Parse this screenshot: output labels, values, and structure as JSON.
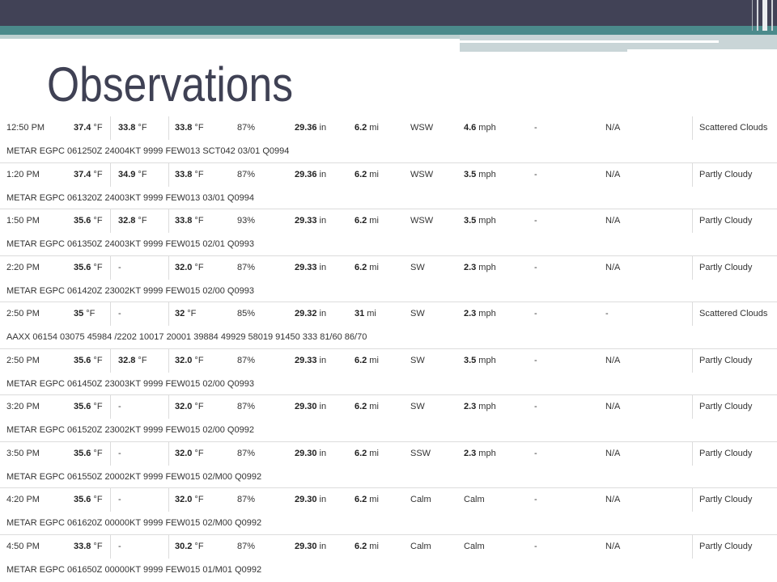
{
  "slide": {
    "title": "Observations"
  },
  "colors": {
    "header_bar": "#414256",
    "accent": "#4b8a8b",
    "title": "#3f4154",
    "rule": "#dcdcdc",
    "text": "#333333"
  },
  "observations": [
    {
      "cells": [
        [
          "12:50 PM"
        ],
        [
          "37.4",
          "°F"
        ],
        [
          "33.8",
          "°F"
        ],
        [
          "33.8",
          "°F"
        ],
        [
          "87%"
        ],
        [
          "29.36",
          "in"
        ],
        [
          "6.2",
          "mi"
        ],
        [
          "WSW"
        ],
        [
          "4.6",
          "mph"
        ],
        [
          "-"
        ],
        [
          "N/A"
        ],
        [
          "Scattered Clouds"
        ]
      ],
      "report": "METAR EGPC 061250Z 24004KT 9999 FEW013 SCT042 03/01 Q0994"
    },
    {
      "cells": [
        [
          "1:20 PM"
        ],
        [
          "37.4",
          "°F"
        ],
        [
          "34.9",
          "°F"
        ],
        [
          "33.8",
          "°F"
        ],
        [
          "87%"
        ],
        [
          "29.36",
          "in"
        ],
        [
          "6.2",
          "mi"
        ],
        [
          "WSW"
        ],
        [
          "3.5",
          "mph"
        ],
        [
          "-"
        ],
        [
          "N/A"
        ],
        [
          "Partly Cloudy"
        ]
      ],
      "report": "METAR EGPC 061320Z 24003KT 9999 FEW013 03/01 Q0994"
    },
    {
      "cells": [
        [
          "1:50 PM"
        ],
        [
          "35.6",
          "°F"
        ],
        [
          "32.8",
          "°F"
        ],
        [
          "33.8",
          "°F"
        ],
        [
          "93%"
        ],
        [
          "29.33",
          "in"
        ],
        [
          "6.2",
          "mi"
        ],
        [
          "WSW"
        ],
        [
          "3.5",
          "mph"
        ],
        [
          "-"
        ],
        [
          "N/A"
        ],
        [
          "Partly Cloudy"
        ]
      ],
      "report": "METAR EGPC 061350Z 24003KT 9999 FEW015 02/01 Q0993"
    },
    {
      "cells": [
        [
          "2:20 PM"
        ],
        [
          "35.6",
          "°F"
        ],
        [
          "-"
        ],
        [
          "32.0",
          "°F"
        ],
        [
          "87%"
        ],
        [
          "29.33",
          "in"
        ],
        [
          "6.2",
          "mi"
        ],
        [
          "SW"
        ],
        [
          "2.3",
          "mph"
        ],
        [
          "-"
        ],
        [
          "N/A"
        ],
        [
          "Partly Cloudy"
        ]
      ],
      "report": "METAR EGPC 061420Z 23002KT 9999 FEW015 02/00 Q0993"
    },
    {
      "cells": [
        [
          "2:50 PM"
        ],
        [
          "35",
          "°F"
        ],
        [
          "-"
        ],
        [
          "32",
          "°F"
        ],
        [
          "85%"
        ],
        [
          "29.32",
          "in"
        ],
        [
          "31",
          "mi"
        ],
        [
          "SW"
        ],
        [
          "2.3",
          "mph"
        ],
        [
          "-"
        ],
        [
          "-"
        ],
        [
          "Scattered Clouds"
        ]
      ],
      "report": "AAXX 06154 03075 45984 /2202 10017 20001 39884 49929 58019 91450 333 81/60 86/70"
    },
    {
      "cells": [
        [
          "2:50 PM"
        ],
        [
          "35.6",
          "°F"
        ],
        [
          "32.8",
          "°F"
        ],
        [
          "32.0",
          "°F"
        ],
        [
          "87%"
        ],
        [
          "29.33",
          "in"
        ],
        [
          "6.2",
          "mi"
        ],
        [
          "SW"
        ],
        [
          "3.5",
          "mph"
        ],
        [
          "-"
        ],
        [
          "N/A"
        ],
        [
          "Partly Cloudy"
        ]
      ],
      "report": "METAR EGPC 061450Z 23003KT 9999 FEW015 02/00 Q0993"
    },
    {
      "cells": [
        [
          "3:20 PM"
        ],
        [
          "35.6",
          "°F"
        ],
        [
          "-"
        ],
        [
          "32.0",
          "°F"
        ],
        [
          "87%"
        ],
        [
          "29.30",
          "in"
        ],
        [
          "6.2",
          "mi"
        ],
        [
          "SW"
        ],
        [
          "2.3",
          "mph"
        ],
        [
          "-"
        ],
        [
          "N/A"
        ],
        [
          "Partly Cloudy"
        ]
      ],
      "report": "METAR EGPC 061520Z 23002KT 9999 FEW015 02/00 Q0992"
    },
    {
      "cells": [
        [
          "3:50 PM"
        ],
        [
          "35.6",
          "°F"
        ],
        [
          "-"
        ],
        [
          "32.0",
          "°F"
        ],
        [
          "87%"
        ],
        [
          "29.30",
          "in"
        ],
        [
          "6.2",
          "mi"
        ],
        [
          "SSW"
        ],
        [
          "2.3",
          "mph"
        ],
        [
          "-"
        ],
        [
          "N/A"
        ],
        [
          "Partly Cloudy"
        ]
      ],
      "report": "METAR EGPC 061550Z 20002KT 9999 FEW015 02/M00 Q0992"
    },
    {
      "cells": [
        [
          "4:20 PM"
        ],
        [
          "35.6",
          "°F"
        ],
        [
          "-"
        ],
        [
          "32.0",
          "°F"
        ],
        [
          "87%"
        ],
        [
          "29.30",
          "in"
        ],
        [
          "6.2",
          "mi"
        ],
        [
          "Calm"
        ],
        [
          "Calm"
        ],
        [
          "-"
        ],
        [
          "N/A"
        ],
        [
          "Partly Cloudy"
        ]
      ],
      "report": "METAR EGPC 061620Z 00000KT 9999 FEW015 02/M00 Q0992"
    },
    {
      "cells": [
        [
          "4:50 PM"
        ],
        [
          "33.8",
          "°F"
        ],
        [
          "-"
        ],
        [
          "30.2",
          "°F"
        ],
        [
          "87%"
        ],
        [
          "29.30",
          "in"
        ],
        [
          "6.2",
          "mi"
        ],
        [
          "Calm"
        ],
        [
          "Calm"
        ],
        [
          "-"
        ],
        [
          "N/A"
        ],
        [
          "Partly Cloudy"
        ]
      ],
      "report": "METAR EGPC 061650Z 00000KT 9999 FEW015 01/M01 Q0992"
    }
  ]
}
